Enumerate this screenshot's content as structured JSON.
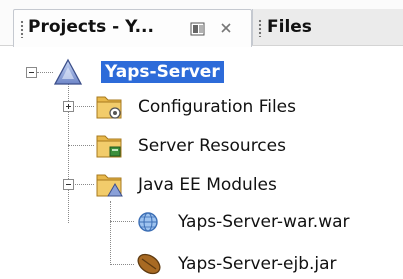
{
  "tabs": {
    "projects_label": "Projects - Y...",
    "files_label": "Files",
    "restore_symbol": "⬛",
    "close_symbol": "✖"
  },
  "tree": {
    "root": {
      "label": "Yaps-Server",
      "icon": "project-triangle-icon",
      "expanded": true,
      "selected": true
    },
    "children": [
      {
        "label": "Configuration Files",
        "icon": "config-folder-icon",
        "expanded": false
      },
      {
        "label": "Server Resources",
        "icon": "server-resources-folder-icon"
      },
      {
        "label": "Java EE Modules",
        "icon": "javaee-modules-folder-icon",
        "expanded": true,
        "children": [
          {
            "label": "Yaps-Server-war.war",
            "icon": "web-module-globe-icon"
          },
          {
            "label": "Yaps-Server-ejb.jar",
            "icon": "ejb-bean-icon"
          }
        ]
      }
    ]
  },
  "colors": {
    "selection": "#2d6bd9",
    "folder": "#e8b84a",
    "tab_border": "#c5c9d0"
  }
}
